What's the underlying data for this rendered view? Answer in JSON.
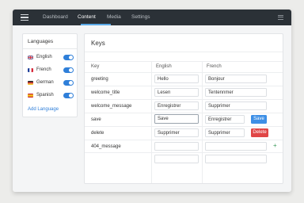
{
  "nav": {
    "tabs": [
      {
        "label": "Dashboard"
      },
      {
        "label": "Content"
      },
      {
        "label": "Media"
      },
      {
        "label": "Settings"
      }
    ],
    "active_tab": "Content"
  },
  "languages": {
    "title": "Languages",
    "items": [
      {
        "name": "English",
        "flag": "uk-flag-icon",
        "enabled": true
      },
      {
        "name": "French",
        "flag": "france-flag-icon",
        "enabled": true
      },
      {
        "name": "German",
        "flag": "germany-flag-icon",
        "enabled": true
      },
      {
        "name": "Spanish",
        "flag": "spain-flag-icon",
        "enabled": true
      }
    ],
    "add_label": "Add Language"
  },
  "keys": {
    "title": "Keys",
    "columns": {
      "key": "Key",
      "english": "English",
      "french": "French"
    },
    "rows": [
      {
        "key": "greeting",
        "english": "Hello",
        "french": "Bonjour"
      },
      {
        "key": "welcome_title",
        "english": "Lesen",
        "french": "Tentennmer"
      },
      {
        "key": "welcome_message",
        "english": "Enregistrer",
        "french": "Supprimer"
      },
      {
        "key": "save",
        "english": "Save",
        "french": "Enregistrer",
        "action": "Save"
      },
      {
        "key": "delete",
        "english": "Supprimer",
        "french": "Supprimer",
        "action": "Delete"
      },
      {
        "key": "404_message",
        "english": "",
        "french": "",
        "action": "+"
      },
      {
        "key": "",
        "english": "",
        "french": ""
      }
    ]
  },
  "colors": {
    "topbar": "#2b3137",
    "accent": "#3d8fe6",
    "danger": "#e04646",
    "add": "#3c9a5c"
  }
}
